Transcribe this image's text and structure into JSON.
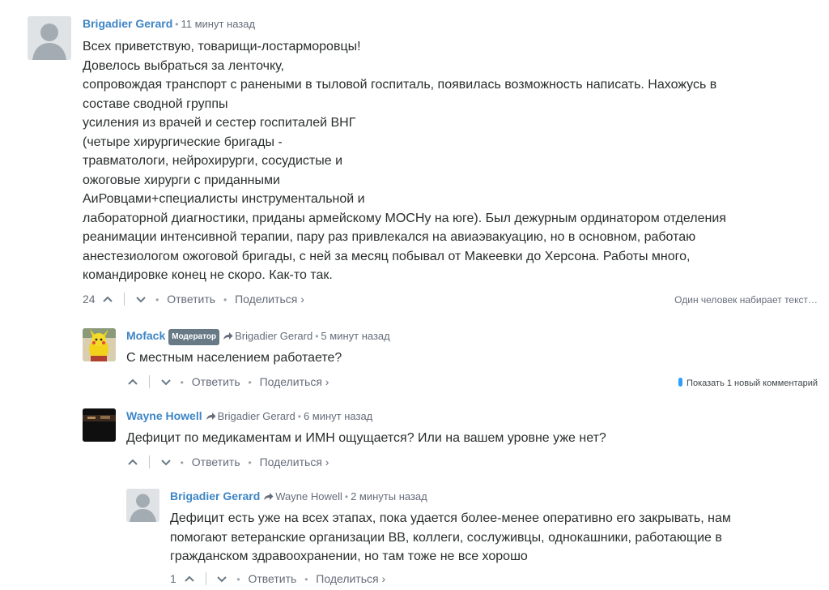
{
  "comments": [
    {
      "author": "Brigadier Gerard",
      "time": "11 минут назад",
      "lines": [
        "Всех приветствую, товарищи-лостарморовцы!",
        "Довелось выбраться за ленточку,",
        "сопровождая транспорт с ранеными в тыловой госпиталь, появилась возможность написать. Нахожусь в",
        "составе сводной группы",
        "усиления из врачей и сестер госпиталей ВНГ",
        "(четыре хирургические бригады -",
        "травматологи, нейрохирурги, сосудистые и",
        "ожоговые хирурги с приданными",
        "АиРовцами+специалисты инструментальной и",
        "лабораторной диагностики, приданы армейскому МОСНу на юге). Был дежурным ординатором отделения",
        "реанимации интенсивной терапии, пару раз привлекался на авиаэвакуацию, но в основном, работаю",
        "анестезиологом ожоговой бригады, с ней за месяц побывал от Макеевки до Херсона. Работы много,",
        "командировке конец не скоро. Как-то так."
      ],
      "votes": "24",
      "reply": "Ответить",
      "share": "Поделиться ›",
      "typing": "Один человек набирает текст…"
    },
    {
      "author": "Mofack",
      "badge": "Модератор",
      "parent": "Brigadier Gerard",
      "time": "5 минут назад",
      "lines": [
        "С местным населением работаете?"
      ],
      "votes": "",
      "reply": "Ответить",
      "share": "Поделиться ›",
      "new_comments": "Показать 1 новый комментарий"
    },
    {
      "author": "Wayne Howell",
      "parent": "Brigadier Gerard",
      "time": "6 минут назад",
      "lines": [
        "Дефицит по медикаментам и ИМН ощущается? Или на вашем уровне уже нет?"
      ],
      "votes": "",
      "reply": "Ответить",
      "share": "Поделиться ›"
    },
    {
      "author": "Brigadier Gerard",
      "parent": "Wayne Howell",
      "time": "2 минуты назад",
      "lines": [
        "Дефицит есть уже на всех этапах, пока удается более-менее оперативно его закрывать, нам",
        "помогают ветеранские организации ВВ, коллеги, сослуживцы, однокашники, работающие в",
        "гражданском здравоохранении, но там тоже не все хорошо"
      ],
      "votes": "1",
      "reply": "Ответить",
      "share": "Поделиться ›"
    }
  ],
  "colors": {
    "author": "#3d85c6",
    "meta": "#656c7a",
    "text": "#2a2e2e",
    "badge_bg": "#687a86",
    "accent": "#2e9fff"
  }
}
